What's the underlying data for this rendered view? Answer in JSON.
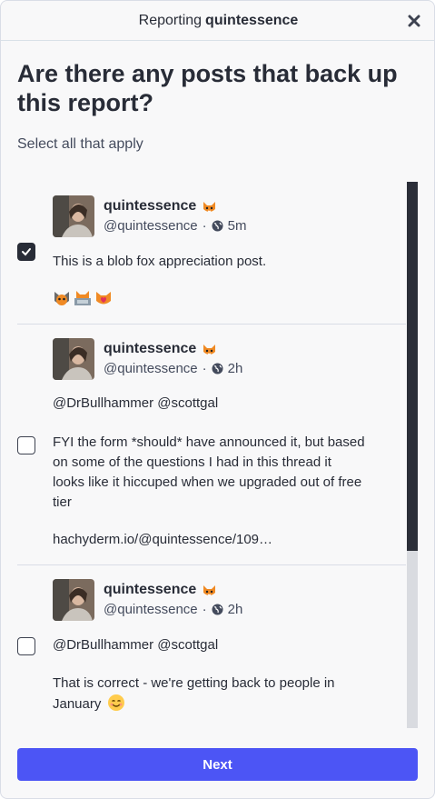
{
  "header": {
    "prefix": "Reporting",
    "username": "quintessence"
  },
  "question": "Are there any posts that back up this report?",
  "subtitle": "Select all that apply",
  "posts": [
    {
      "display_name": "quintessence",
      "handle": "@quintessence",
      "separator": "·",
      "time": "5m",
      "checked": true,
      "text": "This is a blob fox appreciation post."
    },
    {
      "display_name": "quintessence",
      "handle": "@quintessence",
      "separator": "·",
      "time": "2h",
      "checked": false,
      "mentions": "@DrBullhammer @scottgal",
      "text": "FYI the form *should* have announced it, but based on some of the questions I had in this thread it looks like it hiccuped when we upgraded out of free tier",
      "link": "hachyderm.io/@quintessence/109…"
    },
    {
      "display_name": "quintessence",
      "handle": "@quintessence",
      "separator": "·",
      "time": "2h",
      "checked": false,
      "mentions": "@DrBullhammer @scottgal",
      "text": "That is correct - we're getting back to people in January"
    }
  ],
  "next_button": "Next",
  "colors": {
    "accent": "#4c55f5",
    "mention": "#5c6fd6",
    "text": "#282c37",
    "scrollbar_thumb": "#2b2e38"
  },
  "icons": {
    "close": "close-icon",
    "globe": "globe-icon",
    "fox_emoji": "blobfox-icon",
    "check": "check-icon",
    "smile_emoji": "smiling-face-emoji"
  }
}
